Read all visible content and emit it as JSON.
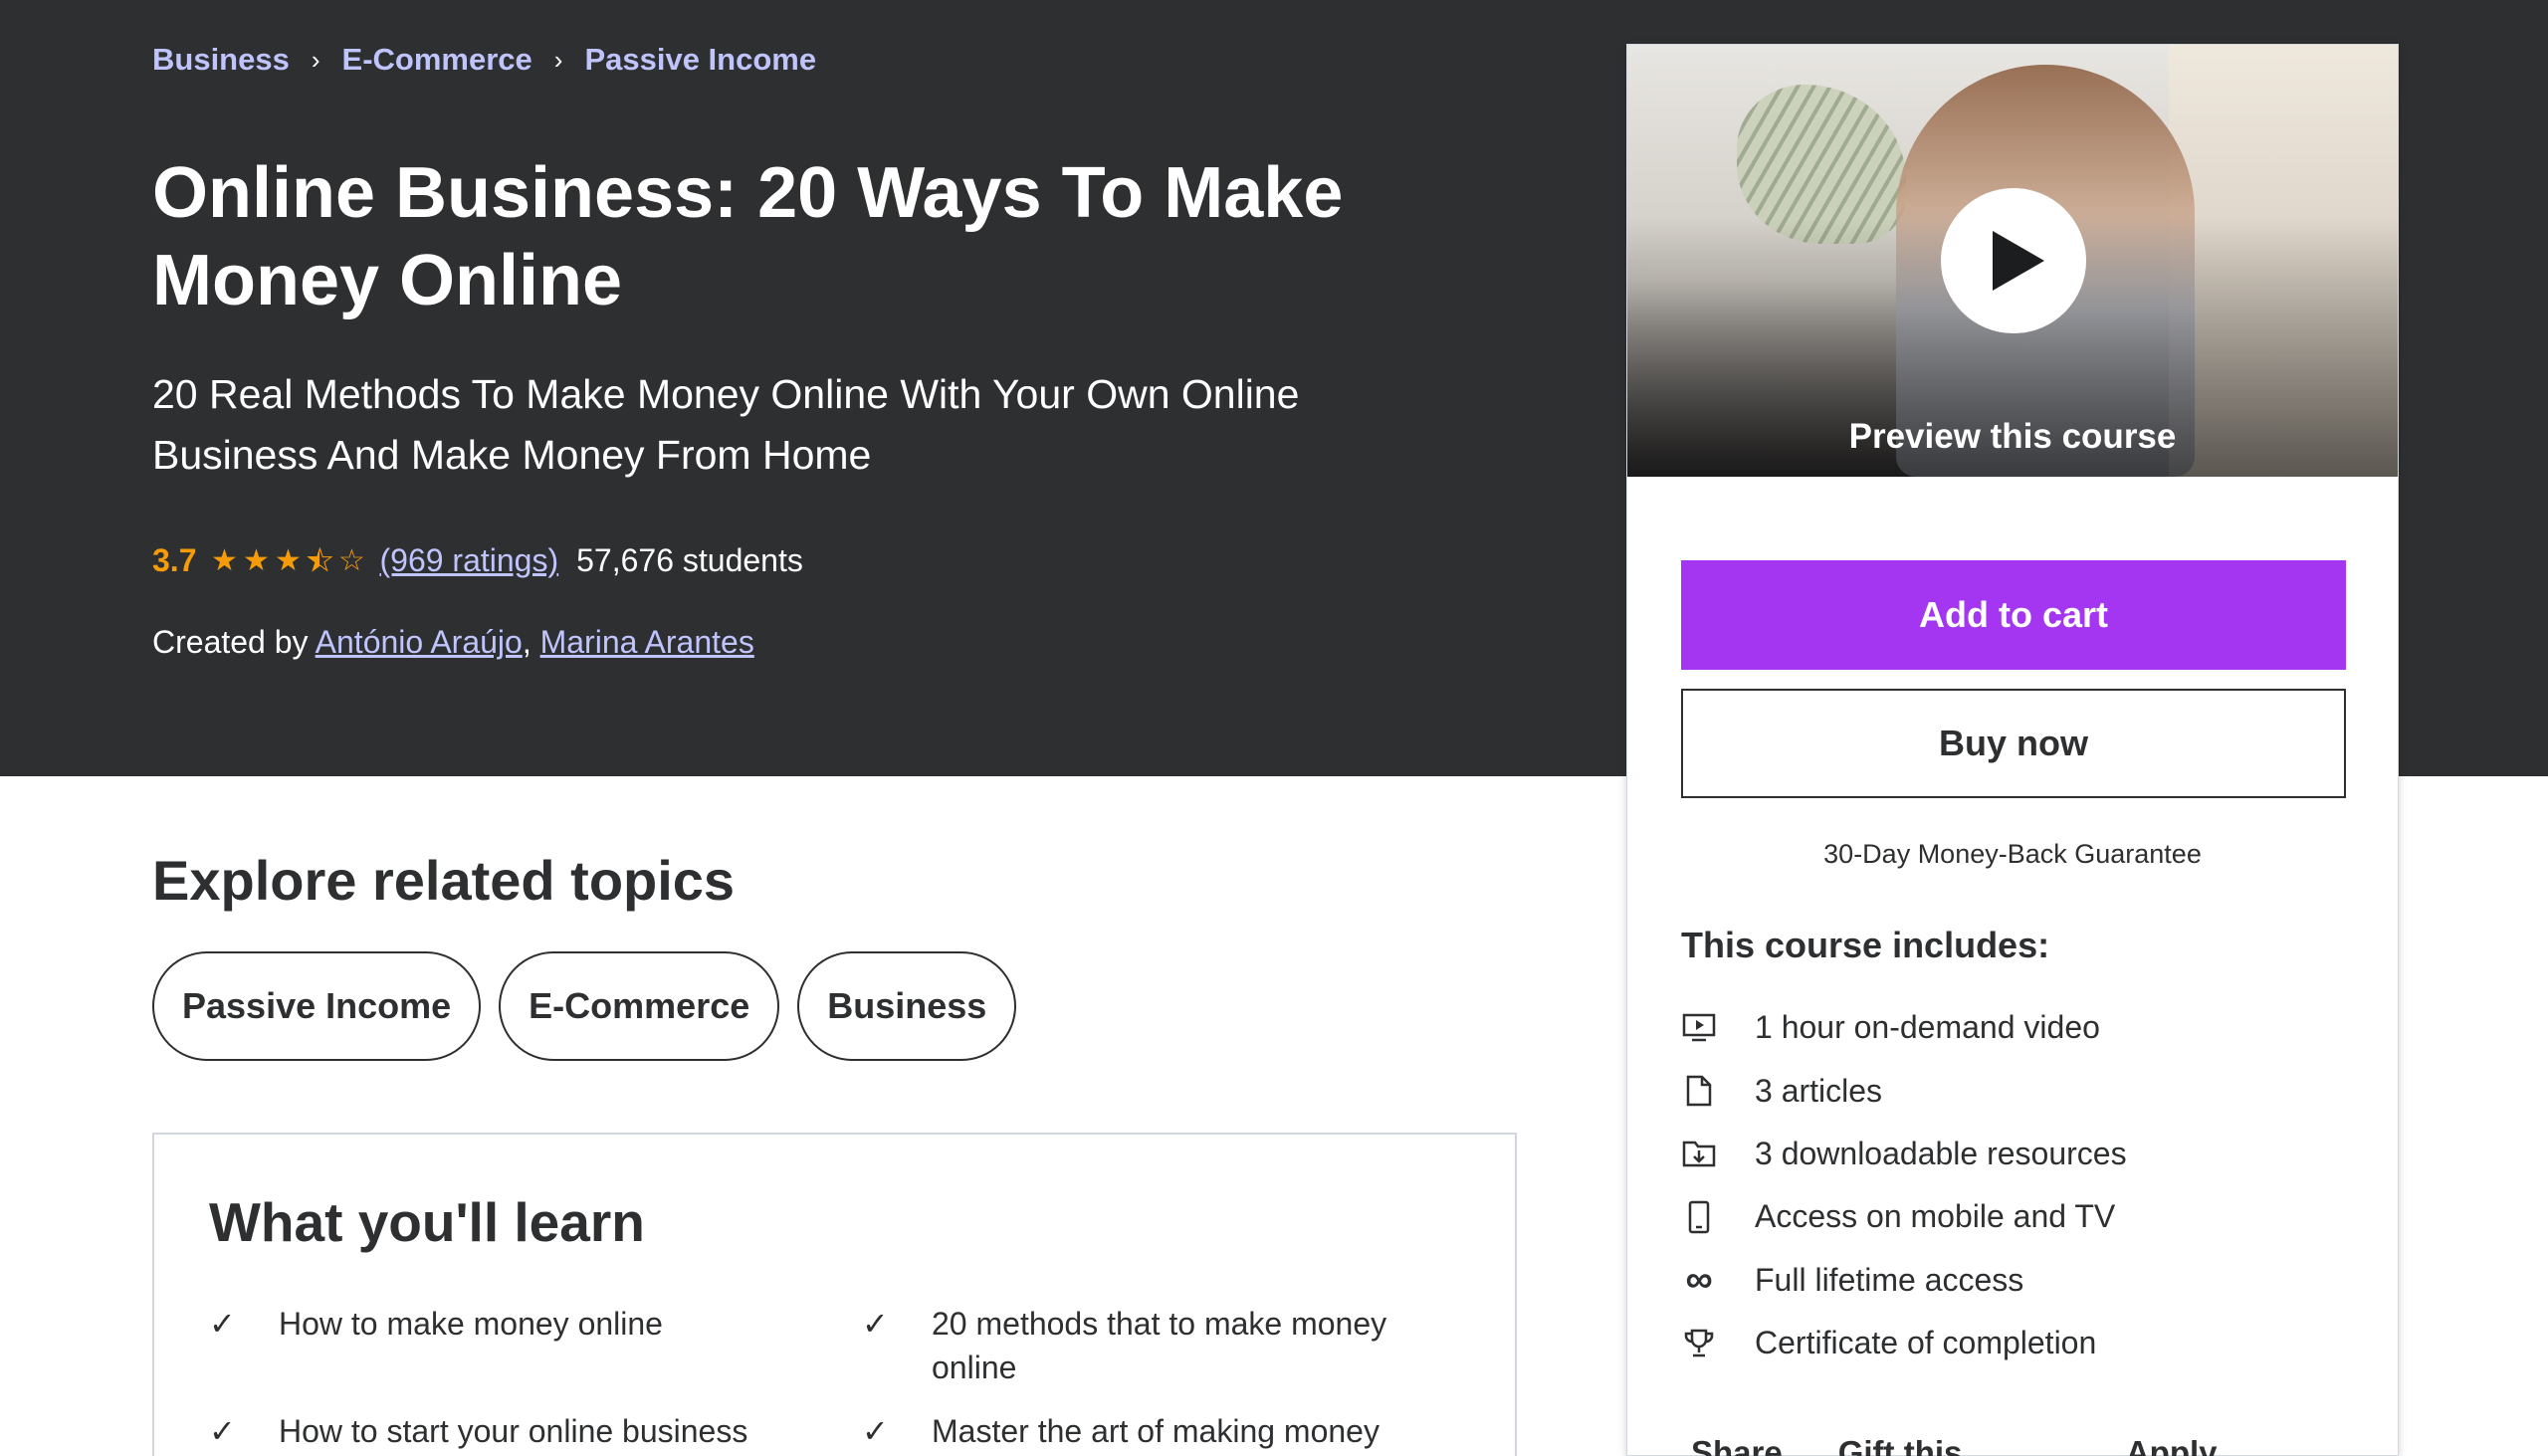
{
  "breadcrumb": [
    "Business",
    "E-Commerce",
    "Passive Income"
  ],
  "course": {
    "title": "Online Business: 20 Ways To Make Money Online",
    "subtitle": "20 Real Methods To Make Money Online With Your Own Online Business And Make Money From Home",
    "rating": "3.7",
    "rating_stars": 3.5,
    "ratings_count": "(969 ratings)",
    "students": "57,676 students",
    "created_by_label": "Created by",
    "instructors": [
      "António Araújo",
      "Marina Arantes"
    ],
    "separator": ","
  },
  "sidebar": {
    "preview_label": "Preview this course",
    "add_to_cart": "Add to cart",
    "buy_now": "Buy now",
    "guarantee": "30-Day Money-Back Guarantee",
    "includes_title": "This course includes:",
    "includes": [
      {
        "icon": "video-icon",
        "label": "1 hour on-demand video"
      },
      {
        "icon": "file-icon",
        "label": "3 articles"
      },
      {
        "icon": "download-folder-icon",
        "label": "3 downloadable resources"
      },
      {
        "icon": "mobile-icon",
        "label": "Access on mobile and TV"
      },
      {
        "icon": "infinity-icon",
        "label": "Full lifetime access"
      },
      {
        "icon": "trophy-icon",
        "label": "Certificate of completion"
      }
    ],
    "links": [
      "Share",
      "Gift this course",
      "Apply Coupon"
    ]
  },
  "explore": {
    "title": "Explore related topics",
    "topics": [
      "Passive Income",
      "E-Commerce",
      "Business"
    ]
  },
  "learn": {
    "title": "What you'll learn",
    "items": [
      "How to make money online",
      "20 methods that to make money online",
      "How to start your online business",
      "Master the art of making money"
    ]
  },
  "colors": {
    "hero_bg": "#2d2f31",
    "accent_purple": "#a435f0",
    "link_lavender": "#c0c4fc",
    "star_orange": "#f69c08"
  }
}
